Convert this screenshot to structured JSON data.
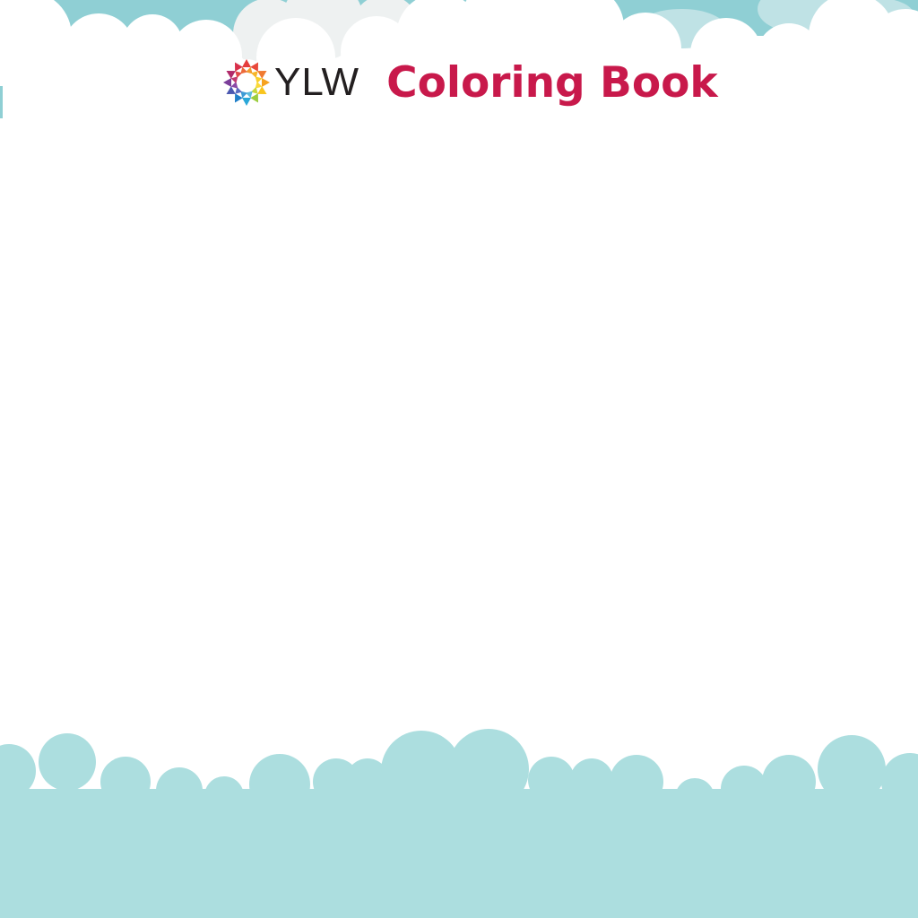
{
  "header": {
    "brand": "YLW",
    "title": "Coloring Book"
  },
  "colors": {
    "sky_top": "#8fcfd4",
    "sky_top_light": "#bfe2e5",
    "cloud_grey": "#eef1f1",
    "cloud_white": "#ffffff",
    "ground": "#acdedf",
    "title_color": "#c8194b",
    "brand_text_color": "#231f20"
  },
  "icons": {
    "logo": "ylw-sunburst-logo-icon"
  }
}
